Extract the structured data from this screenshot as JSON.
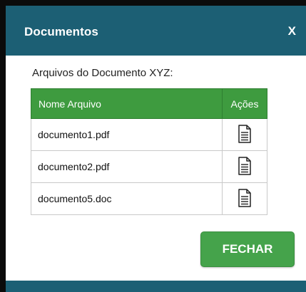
{
  "dialog": {
    "title": "Documentos",
    "close_label": "X",
    "caption": "Arquivos do Documento XYZ:",
    "table": {
      "headers": [
        "Nome Arquivo",
        "Ações"
      ],
      "rows": [
        {
          "name": "documento1.pdf",
          "action_icon": "document-icon"
        },
        {
          "name": "documento2.pdf",
          "action_icon": "document-icon"
        },
        {
          "name": "documento5.doc",
          "action_icon": "document-icon"
        }
      ]
    },
    "close_button_label": "FECHAR"
  },
  "colors": {
    "header_bg": "#1c5f74",
    "table_header_bg": "#3e9b3f",
    "button_bg": "#45a34b",
    "backdrop": "#0b0b0b"
  }
}
